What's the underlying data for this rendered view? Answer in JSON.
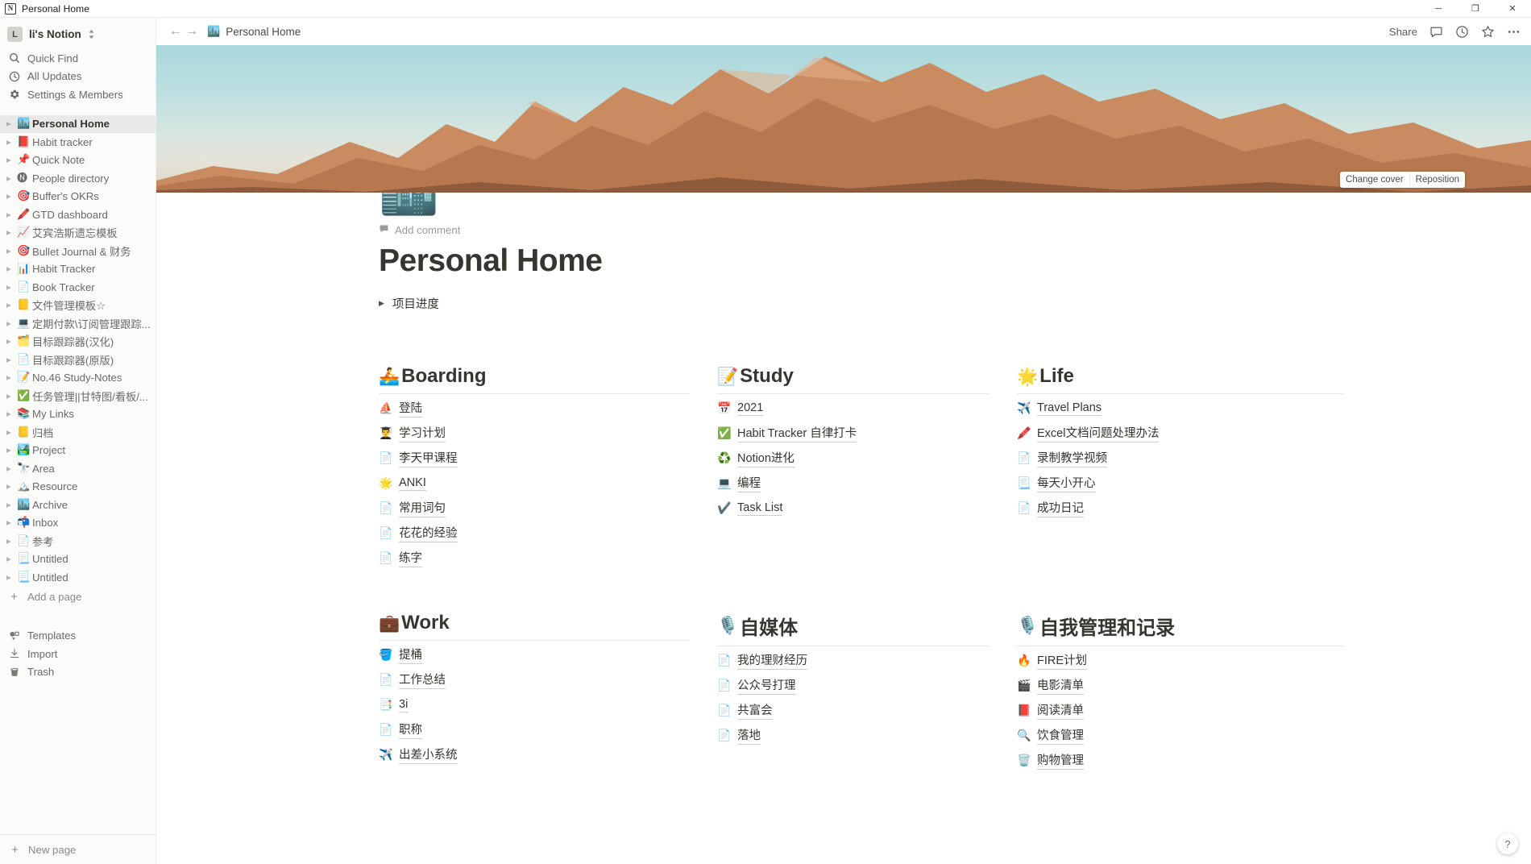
{
  "window": {
    "title": "Personal Home",
    "app_icon": "notion-icon",
    "minimize": "─",
    "maximize": "❐",
    "close": "✕"
  },
  "sidebar": {
    "workspace": {
      "avatar_letter": "L",
      "name": "li's Notion",
      "chevron": "sort-chevrons-icon"
    },
    "nav": [
      {
        "label": "Quick Find",
        "icon": "search-icon"
      },
      {
        "label": "All Updates",
        "icon": "clock-icon"
      },
      {
        "label": "Settings & Members",
        "icon": "gear-icon"
      }
    ],
    "pages": [
      {
        "label": "Personal Home",
        "emoji": "🏙️",
        "active": true
      },
      {
        "label": "Habit tracker",
        "emoji": "📕",
        "active": false
      },
      {
        "label": "Quick Note",
        "emoji": "📌",
        "active": false
      },
      {
        "label": "People directory",
        "emoji": "🅝",
        "active": false
      },
      {
        "label": "Buffer's OKRs",
        "emoji": "🎯",
        "active": false
      },
      {
        "label": "GTD dashboard",
        "emoji": "🖍️",
        "active": false
      },
      {
        "label": "艾宾浩斯遗忘模板",
        "emoji": "📈",
        "active": false
      },
      {
        "label": "Bullet Journal & 财务",
        "emoji": "🎯",
        "active": false
      },
      {
        "label": "Habit Tracker",
        "emoji": "📊",
        "active": false
      },
      {
        "label": "Book Tracker",
        "emoji": "📄",
        "active": false
      },
      {
        "label": "文件管理模板☆",
        "emoji": "📒",
        "active": false
      },
      {
        "label": "定期付款\\订阅管理跟踪...",
        "emoji": "💻",
        "active": false
      },
      {
        "label": "目标跟踪器(汉化)",
        "emoji": "🗂️",
        "active": false
      },
      {
        "label": "目标跟踪器(原版)",
        "emoji": "📄",
        "active": false
      },
      {
        "label": "No.46 Study-Notes",
        "emoji": "📝",
        "active": false
      },
      {
        "label": "任务管理||甘特图/看板/...",
        "emoji": "✅",
        "active": false
      },
      {
        "label": "My Links",
        "emoji": "📚",
        "active": false
      },
      {
        "label": "归档",
        "emoji": "📒",
        "active": false
      },
      {
        "label": "Project",
        "emoji": "🏞️",
        "active": false
      },
      {
        "label": "Area",
        "emoji": "🔭",
        "active": false
      },
      {
        "label": "Resource",
        "emoji": "🏔️",
        "active": false
      },
      {
        "label": "Archive",
        "emoji": "🏙️",
        "active": false
      },
      {
        "label": "Inbox",
        "emoji": "📬",
        "active": false
      },
      {
        "label": "参考",
        "emoji": "📄",
        "active": false
      },
      {
        "label": "Untitled",
        "emoji": "📃",
        "active": false
      },
      {
        "label": "Untitled",
        "emoji": "📃",
        "active": false
      }
    ],
    "add_a_page": "Add a page",
    "bottom": [
      {
        "label": "Templates",
        "icon": "templates-icon"
      },
      {
        "label": "Import",
        "icon": "import-icon"
      },
      {
        "label": "Trash",
        "icon": "trash-icon"
      }
    ],
    "new_page": "New page"
  },
  "topbar": {
    "back": "←",
    "forward": "→",
    "breadcrumb_emoji": "🏙️",
    "breadcrumb": "Personal Home",
    "share": "Share",
    "comment_icon": "comment-icon",
    "updates_icon": "clock-icon",
    "favorite_icon": "star-icon",
    "more_icon": "more-horizontal-icon"
  },
  "cover": {
    "change_cover": "Change cover",
    "reposition": "Reposition"
  },
  "page": {
    "emoji": "🏙️",
    "add_comment": "Add comment",
    "title": "Personal Home",
    "toggle": "项目进度"
  },
  "columns_row1": [
    {
      "title": "Boarding",
      "emoji": "🚣",
      "items": [
        {
          "label": "登陆",
          "emoji": "⛵"
        },
        {
          "label": "学习计划",
          "emoji": "👨‍🎓"
        },
        {
          "label": "李天甲课程",
          "emoji": "📄"
        },
        {
          "label": "ANKI",
          "emoji": "🌟"
        },
        {
          "label": "常用词句",
          "emoji": "📄"
        },
        {
          "label": "花花的经验",
          "emoji": "📄"
        },
        {
          "label": "练字",
          "emoji": "📄"
        }
      ]
    },
    {
      "title": "Study",
      "emoji": "📝",
      "items": [
        {
          "label": "2021",
          "emoji": "📅"
        },
        {
          "label": "Habit Tracker 自律打卡",
          "emoji": "✅"
        },
        {
          "label": "Notion进化",
          "emoji": "♻️"
        },
        {
          "label": "编程",
          "emoji": "💻"
        },
        {
          "label": "Task List",
          "emoji": "✔️"
        }
      ]
    },
    {
      "title": "Life",
      "emoji": "🌟",
      "items": [
        {
          "label": "Travel Plans",
          "emoji": "✈️"
        },
        {
          "label": "Excel文档问题处理办法",
          "emoji": "🖍️"
        },
        {
          "label": "录制教学视频",
          "emoji": "📄"
        },
        {
          "label": "每天小开心",
          "emoji": "📃"
        },
        {
          "label": "成功日记",
          "emoji": "📄"
        }
      ]
    }
  ],
  "columns_row2": [
    {
      "title": "Work",
      "emoji": "💼",
      "items": [
        {
          "label": "提桶",
          "emoji": "🪣"
        },
        {
          "label": "工作总结",
          "emoji": "📄"
        },
        {
          "label": "3i",
          "emoji": "📑"
        },
        {
          "label": "职称",
          "emoji": "📄"
        },
        {
          "label": "出差小系统",
          "emoji": "✈️"
        }
      ]
    },
    {
      "title": "自媒体",
      "emoji": "🎙️",
      "items": [
        {
          "label": "我的理财经历",
          "emoji": "📄"
        },
        {
          "label": "公众号打理",
          "emoji": "📄"
        },
        {
          "label": "共富会",
          "emoji": "📄"
        },
        {
          "label": "落地",
          "emoji": "📄"
        }
      ]
    },
    {
      "title": "自我管理和记录",
      "emoji": "🎙️",
      "items": [
        {
          "label": "FIRE计划",
          "emoji": "🔥"
        },
        {
          "label": "电影清单",
          "emoji": "🎬"
        },
        {
          "label": "阅读清单",
          "emoji": "📕"
        },
        {
          "label": "饮食管理",
          "emoji": "🔍"
        },
        {
          "label": "购物管理",
          "emoji": "🗑️"
        }
      ]
    }
  ],
  "help": {
    "label": "?"
  },
  "colors": {
    "sidebar_bg": "#fbfbfa",
    "active_row": "#e9e9e7",
    "text": "#37352f",
    "muted": "#6b6a66"
  }
}
